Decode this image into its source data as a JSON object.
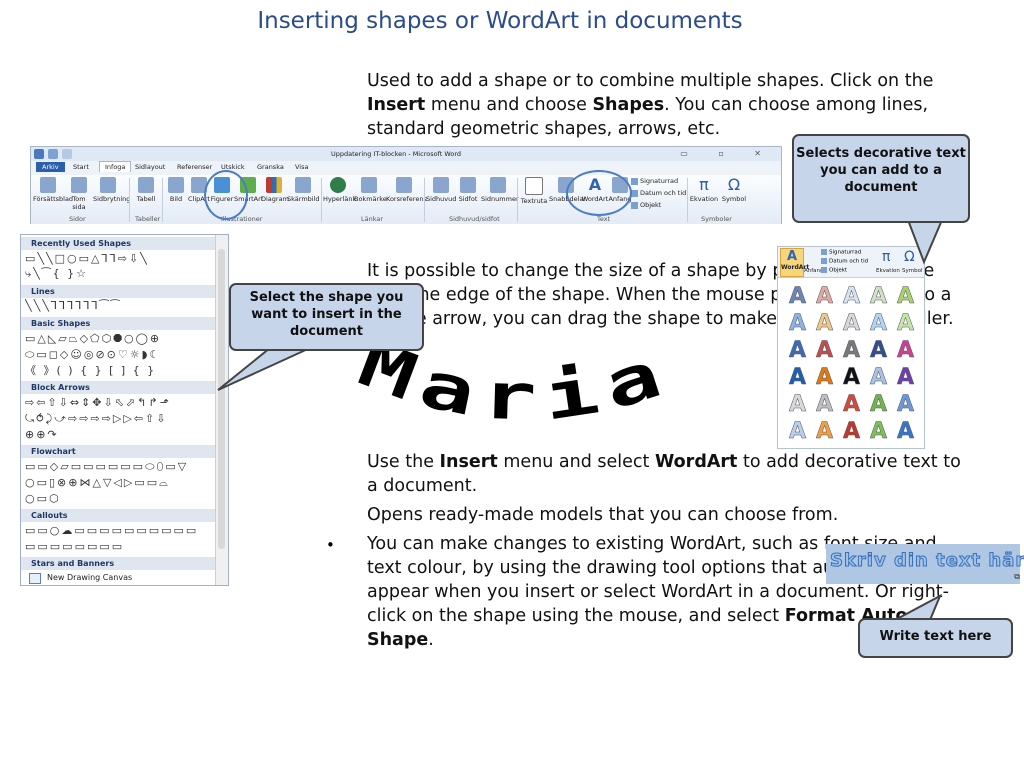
{
  "title": "Inserting shapes or WordArt in documents",
  "intro": {
    "pre": "Used to add a shape or to combine multiple shapes. Click on the ",
    "b1": "Insert",
    "mid": " menu and choose ",
    "b2": "Shapes",
    "post": ". You can choose among lines, standard geometric shapes, arrows, etc."
  },
  "resize_text": "It is possible to change the size of a shape by placing the mouse over the edge of the shape. When the mouse pointer changes to a double arrow, you can drag the shape to make it bigger or smaller.",
  "wordart": {
    "p1_pre": "Use the ",
    "p1_b1": "Insert",
    "p1_mid": " menu and select ",
    "p1_b2": "WordArt",
    "p1_post": " to add decorative text to a document.",
    "p2": "Opens ready-made models that you can choose from.",
    "bullet": "•",
    "p3": "You can make changes to existing WordArt, such as font size and text colour, by using the drawing tool options that automatically appear when you insert or select WordArt in a document. Or right-click on the shape using the mouse, and select ",
    "p3_b": "Format Auto Shape",
    "p3_end": ".",
    "sample": "Maria"
  },
  "callouts": {
    "decorative": "Selects decorative text you can add to a document",
    "select_shape": "Select the shape you want to insert in the document",
    "write_text": "Write text here"
  },
  "ribbon": {
    "window_title": "Uppdatering IT-blocken - Microsoft Word",
    "window_controls": "▭ ▫ ✕",
    "tabs": [
      "Arkiv",
      "Start",
      "Infoga",
      "Sidlayout",
      "Referenser",
      "Utskick",
      "Granska",
      "Visa"
    ],
    "buttons": [
      "Försättsblad",
      "Tom sida",
      "Sidbrytning",
      "Tabell",
      "Bild",
      "ClipArt",
      "Figurer",
      "SmartArt",
      "Diagram",
      "Skärmbild",
      "Hyperlänk",
      "Bokmärke",
      "Korsreferens",
      "Sidhuvud",
      "Sidfot",
      "Sidnummer",
      "Textruta",
      "Snabbdelar",
      "WordArt",
      "Anfang",
      "Ekvation",
      "Symbol"
    ],
    "side_items": [
      "Signaturrad",
      "Datum och tid",
      "Objekt"
    ],
    "groups": [
      "Sidor",
      "Tabeller",
      "Illustrationer",
      "Länkar",
      "Sidhuvud/sidfot",
      "Text",
      "Symboler"
    ]
  },
  "shapes_panel": {
    "categories": [
      "Recently Used Shapes",
      "Lines",
      "Basic Shapes",
      "Block Arrows",
      "Flowchart",
      "Callouts",
      "Stars and Banners"
    ],
    "new_canvas": "New Drawing Canvas",
    "rows": {
      "recent": [
        "▭╲╲□○▭△⅂⅂⇨⇩╲",
        "⤷╲⁀{ }☆"
      ],
      "lines": [
        "╲╲╲⅂⅂⅂⅂⅂⅂⁀⁀"
      ],
      "basic": [
        "▭△◺▱⏢◇⬠⬡⯃○◯⊕",
        "⬭▭◻◇☺◎⊘⊙♡☼◗☾",
        "《 》( ) { } [ ] { }"
      ],
      "arrows": [
        "⇨⇦⇧⇩⇔⇕✥⇩⬁⬀↰↱⬏",
        "⤿⥀⤸⤻⇨⇨⇨⇨▷▷⇦⇧⇩",
        "⊕⊕↷"
      ],
      "flowchart": [
        "▭▭◇▱▭▭▭▭▭▭⬭⬯▭▽",
        "○▭▯⊗⊕⋈△▽◁▷▭▭⌓",
        "○▭⬡"
      ],
      "callouts": [
        "▭▭○☁▭▭▭▭▭▭▭▭▭▭",
        "▭▭▭▭▭▭▭▭"
      ]
    }
  },
  "gallery": {
    "wordart_label": "WordArt",
    "anfang_label": "Anfang",
    "pi": "π",
    "omega": "Ω",
    "ekvation_label": "Ekvation",
    "symbol_label": "Symbol",
    "side_items": [
      "Signaturrad",
      "Datum och tid",
      "Objekt"
    ],
    "samples": [
      "A",
      "A",
      "A",
      "A",
      "A",
      "A",
      "A",
      "A",
      "A",
      "A",
      "A",
      "A",
      "A",
      "A",
      "A",
      "A",
      "A",
      "A",
      "A",
      "A",
      "A",
      "A",
      "A",
      "A",
      "A",
      "A",
      "A",
      "A",
      "A",
      "A"
    ],
    "colors": [
      "#6a87b6",
      "#e0aaa0",
      "#d8e4f2",
      "#cfe2c6",
      "#a9d36b",
      "#8eb3e0",
      "#f0c98a",
      "#d9d9d9",
      "#b3d4f4",
      "#c6e6a8",
      "#3d6cb6",
      "#c0504d",
      "#7a7a7a",
      "#2f4f8f",
      "#cf3f92",
      "#1f5fb0",
      "#e07a10",
      "#111111",
      "#a8c3e6",
      "#6d3fa8",
      "#d9d9d9",
      "#bfbfbf",
      "#d14b3b",
      "#6fb844",
      "#6a9ad6",
      "#b8d0ea",
      "#f0a040",
      "#c0392b",
      "#7dbf59",
      "#3874c8"
    ]
  },
  "skriv": {
    "text": "Skriv din text här",
    "handle": "⧉"
  }
}
